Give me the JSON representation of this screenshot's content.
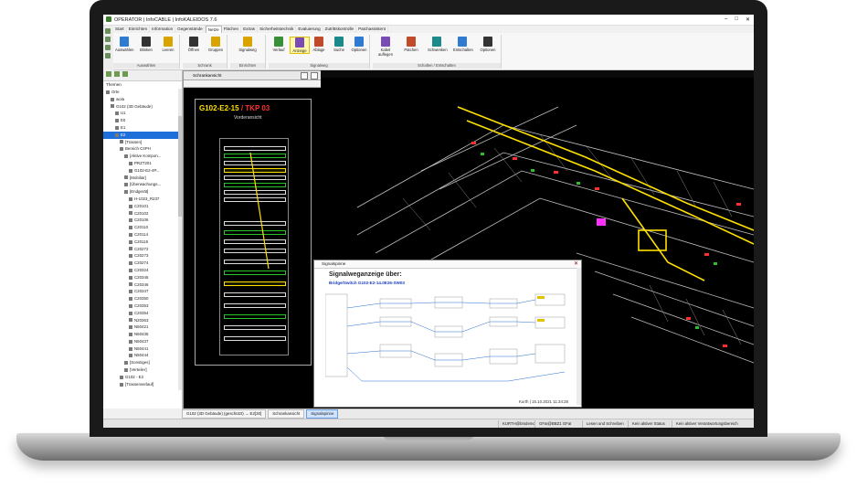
{
  "window": {
    "title": "OPERATOR | InfoCABLE | InfoKALEIDOS 7.6"
  },
  "menu": [
    "Start",
    "Einrichten",
    "Information",
    "Gegenstände",
    "Netze",
    "Flächen",
    "Extras",
    "Sicherheitstechnik",
    "Evaluierung",
    "Zutrittskontrolle",
    "Patchassistent"
  ],
  "menu_active": "Netze",
  "ribbon": {
    "groups": [
      {
        "label": "Auswählen",
        "buttons": [
          "Auswählen",
          "Blinken",
          "Leeren"
        ]
      },
      {
        "label": "Schrank",
        "buttons": [
          "Öffnen",
          "Gruppen"
        ]
      },
      {
        "label": "Einrichten",
        "buttons": [
          "Signalweg"
        ]
      },
      {
        "label": "Signalweg",
        "buttons": [
          "Verlauf",
          "Anzeige",
          "Ablage",
          "Suche",
          "Optionen"
        ]
      },
      {
        "label": "Schalten / Entschalten",
        "buttons": [
          "Kabel auflegen",
          "Patchen",
          "Schwenken",
          "Entschalten",
          "Optionen"
        ]
      }
    ],
    "highlighted": "Anzeige"
  },
  "tree": {
    "header": "Themen",
    "items": [
      {
        "label": "Orte",
        "indent": 0
      },
      {
        "label": "wola",
        "indent": 1
      },
      {
        "label": "G102 (3D Gebäude)",
        "indent": 1
      },
      {
        "label": "U1",
        "indent": 2
      },
      {
        "label": "E0",
        "indent": 2
      },
      {
        "label": "E1",
        "indent": 2
      },
      {
        "label": "E2",
        "indent": 2,
        "selected": true
      },
      {
        "label": "[Trassen]",
        "indent": 3
      },
      {
        "label": "Bereich C4PH",
        "indent": 3
      },
      {
        "label": "[Aktive Kompon...",
        "indent": 4
      },
      {
        "label": "PRZT201",
        "indent": 5
      },
      {
        "label": "G102-E2-4P...",
        "indent": 5
      },
      {
        "label": "[Mobiliar]",
        "indent": 4
      },
      {
        "label": "[Überwachungs...",
        "indent": 4
      },
      {
        "label": "[Endgerät]",
        "indent": 4
      },
      {
        "label": "H-1023_R237",
        "indent": 5
      },
      {
        "label": "C20101",
        "indent": 5
      },
      {
        "label": "C20102",
        "indent": 5
      },
      {
        "label": "C20106",
        "indent": 5
      },
      {
        "label": "C20110",
        "indent": 5
      },
      {
        "label": "C20114",
        "indent": 5
      },
      {
        "label": "C20115",
        "indent": 5
      },
      {
        "label": "C20272",
        "indent": 5
      },
      {
        "label": "C20273",
        "indent": 5
      },
      {
        "label": "C20274",
        "indent": 5
      },
      {
        "label": "C20324",
        "indent": 5
      },
      {
        "label": "C20345",
        "indent": 5
      },
      {
        "label": "C20346",
        "indent": 5
      },
      {
        "label": "C20347",
        "indent": 5
      },
      {
        "label": "C20350",
        "indent": 5
      },
      {
        "label": "C20353",
        "indent": 5
      },
      {
        "label": "C20354",
        "indent": 5
      },
      {
        "label": "N20363",
        "indent": 5
      },
      {
        "label": "N50421",
        "indent": 5
      },
      {
        "label": "N50435",
        "indent": 5
      },
      {
        "label": "N50437",
        "indent": 5
      },
      {
        "label": "N50441",
        "indent": 5
      },
      {
        "label": "N50444",
        "indent": 5
      },
      {
        "label": "[Sonstiges]",
        "indent": 4
      },
      {
        "label": "[Verteiler]",
        "indent": 4
      },
      {
        "label": "G102 - E2",
        "indent": 3
      },
      {
        "label": "[Trassenverlauf]",
        "indent": 3
      }
    ]
  },
  "cabinet_window": {
    "title": "Schrankansicht",
    "name_main": "G102-E2-15",
    "name_suffix": "/ TKP 03",
    "view_label": "Vorderansicht"
  },
  "signal_window": {
    "title": "Signalspinne",
    "heading": "Signalweganzeige über:",
    "subheading": "Bridge/Switch G102-E2-14.0E26-SW03",
    "footer": "Kurth | 15.10.2021 11:34:28"
  },
  "bottom_tabs": {
    "location": "G102 (3D Gebäude) (geschützt) → E2[30]",
    "tabs": [
      "Schrankansicht",
      "Signalspinne"
    ],
    "active": "Signalspinne"
  },
  "statusbar": {
    "user": "KURTH@bmdemo",
    "gfai": "GFaI@BBZ1 GFaI",
    "mode": "Lesen und Schreiben",
    "status": "Kein aktiver Status",
    "responsible": "Kein aktiver Verantwortungsbereich"
  },
  "colors": {
    "accent": "#1e6fd9",
    "cad_bg": "#000000",
    "cad_yellow": "#ffe000",
    "cad_red": "#ff3030",
    "cad_green": "#27c327"
  }
}
